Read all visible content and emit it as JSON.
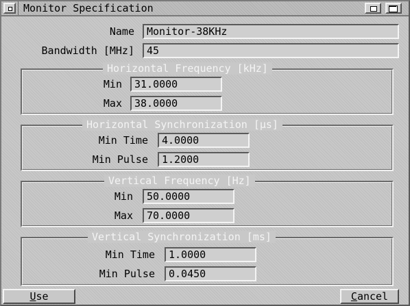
{
  "window": {
    "title": "Monitor Specification"
  },
  "fields": {
    "name": {
      "label": "Name",
      "value": "Monitor-38KHz"
    },
    "bandwidth": {
      "label": "Bandwidth [MHz]",
      "value": "45"
    }
  },
  "groups": {
    "hfreq": {
      "title": "Horizontal Frequency [kHz]",
      "min_label": "Min",
      "min_value": "31.0000",
      "max_label": "Max",
      "max_value": "38.0000"
    },
    "hsync": {
      "title": "Horizontal Synchronization [µs]",
      "time_label": "Min Time",
      "time_value": "4.0000",
      "pulse_label": "Min Pulse",
      "pulse_value": "1.2000"
    },
    "vfreq": {
      "title": "Vertical Frequency [Hz]",
      "min_label": "Min",
      "min_value": "50.0000",
      "max_label": "Max",
      "max_value": "70.0000"
    },
    "vsync": {
      "title": "Vertical Synchronization [ms]",
      "time_label": "Min Time",
      "time_value": "1.0000",
      "pulse_label": "Min Pulse",
      "pulse_value": "0.0450"
    }
  },
  "buttons": {
    "use": {
      "first": "U",
      "rest": "se"
    },
    "cancel": {
      "first": "C",
      "rest": "ancel"
    }
  }
}
